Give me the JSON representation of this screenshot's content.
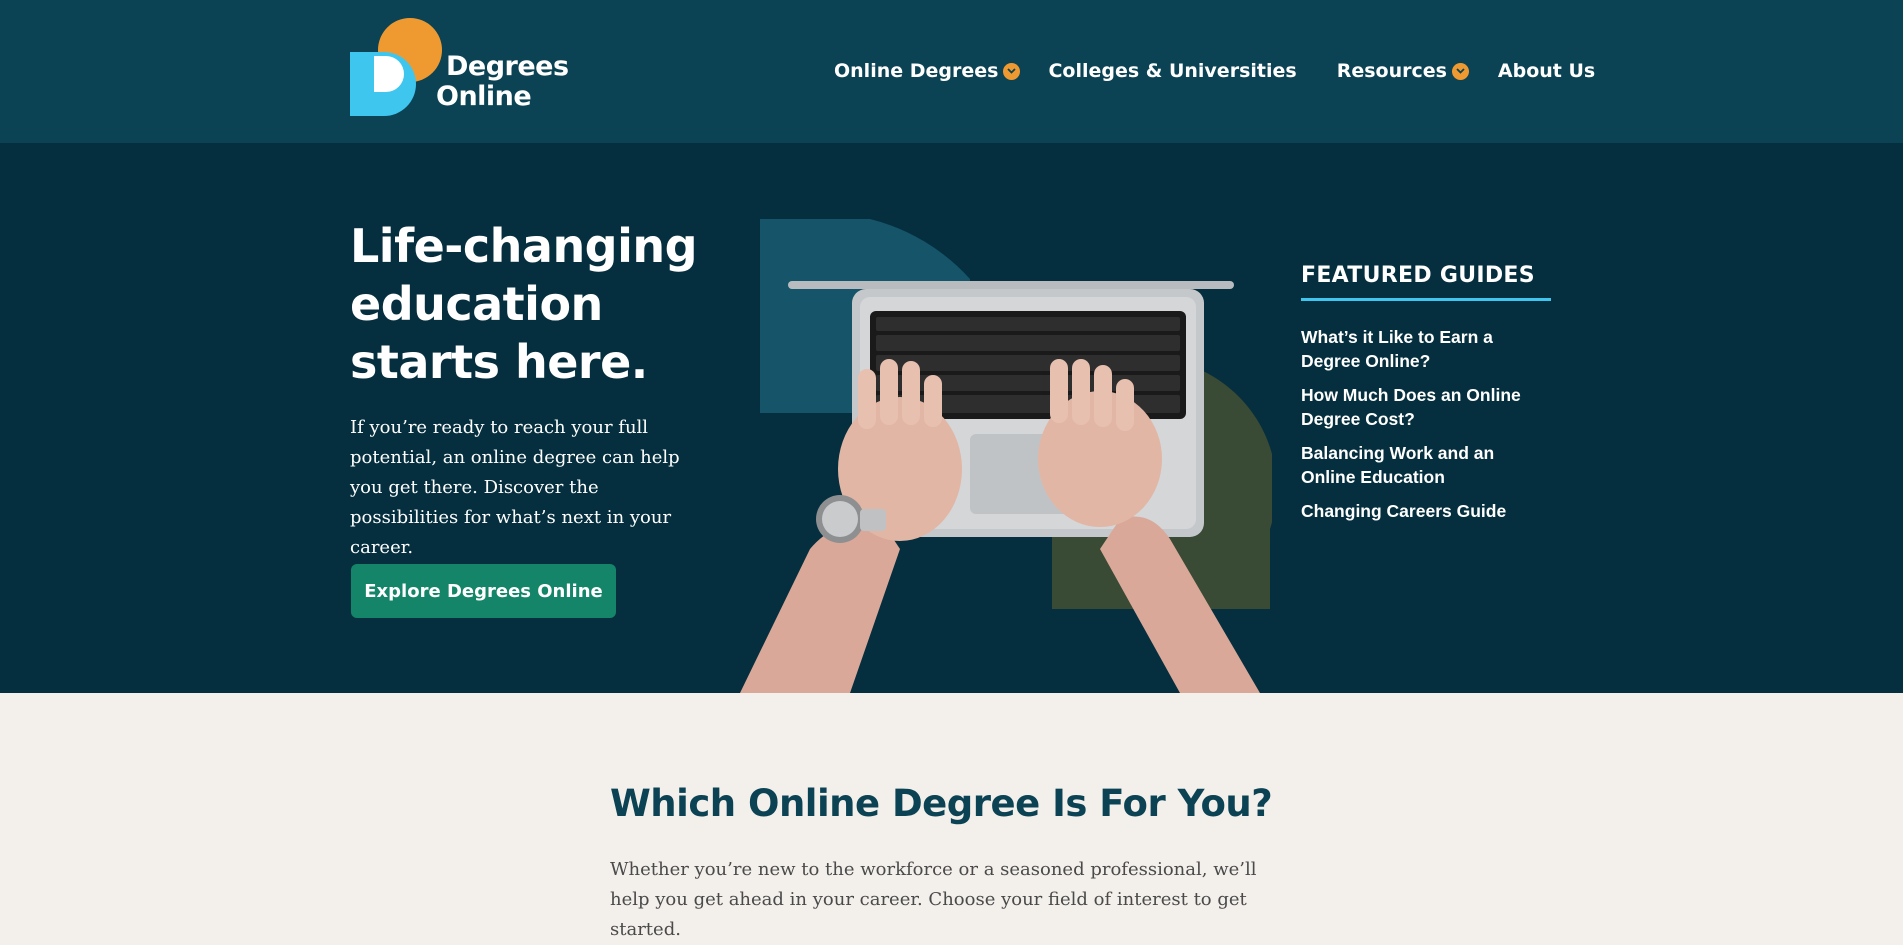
{
  "header": {
    "logo": {
      "line1": "Degrees",
      "line2": "Online"
    },
    "nav": [
      {
        "label": "Online Degrees",
        "has_dropdown": true
      },
      {
        "label": "Colleges & Universities",
        "has_dropdown": false
      },
      {
        "label": "Resources",
        "has_dropdown": true
      },
      {
        "label": "About Us",
        "has_dropdown": false
      }
    ]
  },
  "hero": {
    "title": "Life-changing education starts here.",
    "lead": "If you’re ready to reach your full potential, an online degree can help you get there. Discover the possibilities for what’s next in your career.",
    "cta_label": "Explore Degrees Online",
    "image_icon": "laptop-typing-hands-image"
  },
  "featured": {
    "heading": "FEATURED GUIDES",
    "guides": [
      "What’s it Like to Earn a Degree Online?",
      "How Much Does an Online Degree Cost?",
      "Balancing Work and an Online Education",
      "Changing Careers Guide"
    ]
  },
  "degrees_section": {
    "title": "Which Online Degree Is For You?",
    "lead": "Whether you’re new to the workforce or a seasoned professional, we’ll help you get ahead in your career. Choose your field of interest to get started."
  },
  "colors": {
    "header_bg": "#0b4354",
    "hero_bg": "#052f3e",
    "accent_orange": "#ef9a31",
    "accent_blue": "#3ec6ef",
    "cta_green": "#158569",
    "page_bg": "#f3efeb",
    "heading_teal": "#0b4354"
  }
}
